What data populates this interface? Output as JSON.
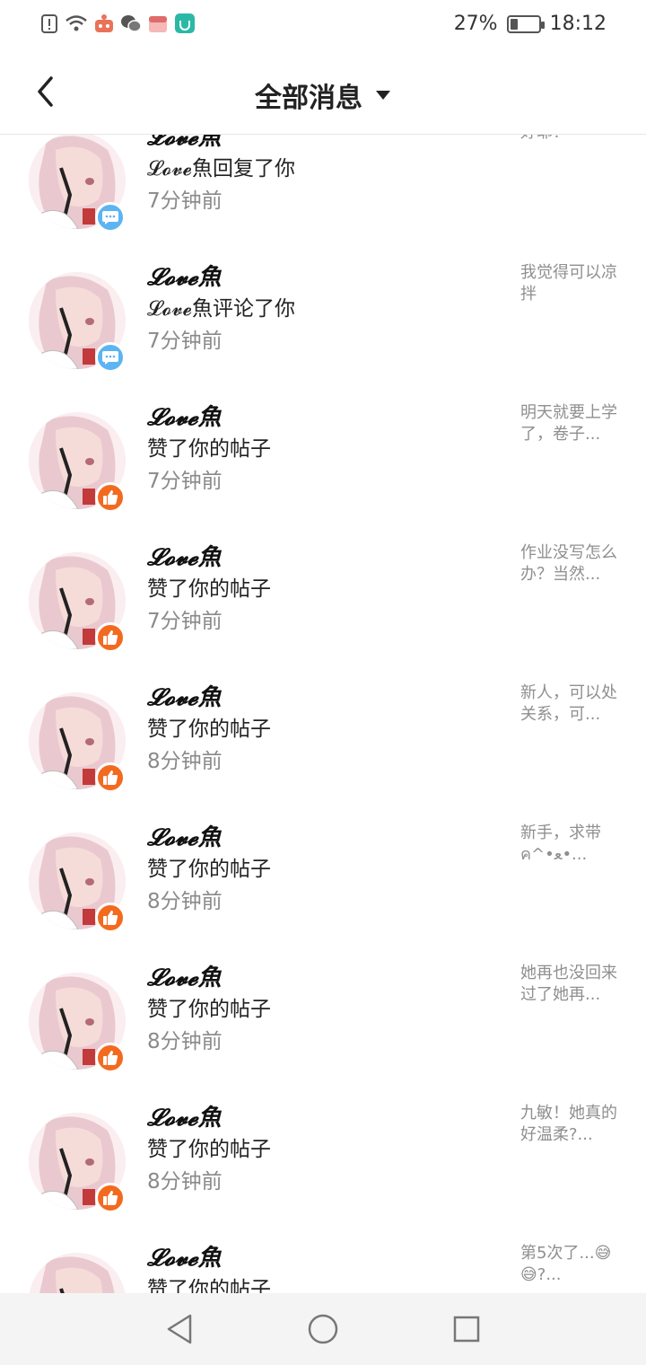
{
  "status_bar": {
    "battery_percent": "27%",
    "battery_level": 0.27,
    "time": "18:12",
    "icons": [
      "sim-alert-icon",
      "wifi-icon",
      "app-notification-icon",
      "wechat-icon",
      "app-notification-icon",
      "mi-app-icon"
    ]
  },
  "header": {
    "title": "全部消息",
    "back_icon": "chevron-left-icon",
    "dropdown_icon": "caret-down-icon"
  },
  "notifications": [
    {
      "user": "𝓛𝓸𝓿𝓮魚",
      "action": "𝓛𝓸𝓿𝓮魚回复了你",
      "time": "7分钟前",
      "type": "comment",
      "preview": "好耶！"
    },
    {
      "user": "𝓛𝓸𝓿𝓮魚",
      "action": "𝓛𝓸𝓿𝓮魚评论了你",
      "time": "7分钟前",
      "type": "comment",
      "preview": "我觉得可以凉拌"
    },
    {
      "user": "𝓛𝓸𝓿𝓮魚",
      "action": "赞了你的帖子",
      "time": "7分钟前",
      "type": "like",
      "preview": "明天就要上学了，卷子..."
    },
    {
      "user": "𝓛𝓸𝓿𝓮魚",
      "action": "赞了你的帖子",
      "time": "7分钟前",
      "type": "like",
      "preview": "作业没写怎么办？当然..."
    },
    {
      "user": "𝓛𝓸𝓿𝓮魚",
      "action": "赞了你的帖子",
      "time": "8分钟前",
      "type": "like",
      "preview": "新人，可以处关系，可..."
    },
    {
      "user": "𝓛𝓸𝓿𝓮魚",
      "action": "赞了你的帖子",
      "time": "8分钟前",
      "type": "like",
      "preview": "新手，求带ค^•ﻌ•..."
    },
    {
      "user": "𝓛𝓸𝓿𝓮魚",
      "action": "赞了你的帖子",
      "time": "8分钟前",
      "type": "like",
      "preview": "她再也没回来过了她再..."
    },
    {
      "user": "𝓛𝓸𝓿𝓮魚",
      "action": "赞了你的帖子",
      "time": "8分钟前",
      "type": "like",
      "preview": "九敏！她真的好温柔?..."
    },
    {
      "user": "𝓛𝓸𝓿𝓮魚",
      "action": "赞了你的帖子",
      "time": "",
      "type": "like",
      "preview": "第5次了...😅😅?..."
    }
  ],
  "colors": {
    "comment_badge": "#5cb4f2",
    "like_badge": "#f36a1f",
    "secondary_text": "#8a8a8a",
    "nav_background": "#f4f4f4"
  },
  "nav": {
    "back_icon": "triangle-back-icon",
    "home_icon": "circle-home-icon",
    "recents_icon": "square-recents-icon"
  }
}
